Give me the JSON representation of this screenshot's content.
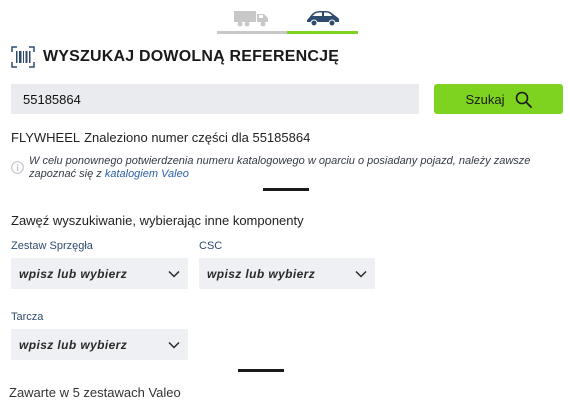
{
  "vehicle_tabs": [
    {
      "icon": "truck-icon",
      "active": false
    },
    {
      "icon": "car-icon",
      "active": true
    }
  ],
  "colors": {
    "accent": "#7ed321",
    "link": "#2a5da8",
    "inactive_tab": "#c8c8c8"
  },
  "header": {
    "title": "WYSZUKAJ DOWOLNĄ REFERENCJĘ",
    "icon": "barcode-icon"
  },
  "search": {
    "value": "55185864",
    "button_label": "Szukaj",
    "button_icon": "search-icon"
  },
  "result": {
    "part_type": "FLYWHEEL",
    "text": "Znaleziono numer części dla 55185864"
  },
  "notice": {
    "text": "W celu ponownego potwierdzenia numeru katalogowego w oparciu o posiadany pojazd, należy zawsze zapoznać się z ",
    "link_label": "katalogiem Valeo"
  },
  "refine": {
    "title": "Zawęź wyszukiwanie, wybierając inne komponenty",
    "filters": [
      {
        "label": "Zestaw Sprzęgła",
        "placeholder": "wpisz lub wybierz"
      },
      {
        "label": "CSC",
        "placeholder": "wpisz lub wybierz"
      },
      {
        "label": "Tarcza",
        "placeholder": "wpisz lub wybierz"
      }
    ]
  },
  "footer": {
    "contained_text": "Zawarte w 5 zestawach Valeo"
  }
}
